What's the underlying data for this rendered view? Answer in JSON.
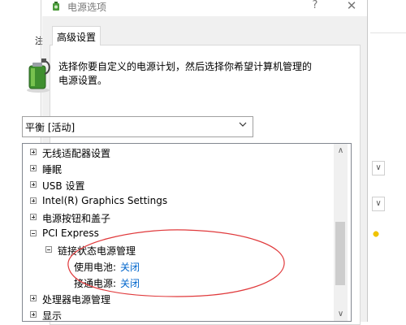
{
  "background": {
    "left_fragment": "注",
    "right_chevrons": [
      "∨",
      "∨"
    ]
  },
  "dialog": {
    "title": "电源选项",
    "help_label": "?",
    "close_label": "✕",
    "tab_label": "高级设置",
    "description": "选择你要自定义的电源计划，然后选择你希望计算机管理的电源设置。",
    "plan_select": {
      "value": "平衡 [活动]"
    },
    "tree": {
      "items": [
        {
          "label": "无线适配器设置",
          "state": "collapsed"
        },
        {
          "label": "睡眠",
          "state": "collapsed"
        },
        {
          "label": "USB 设置",
          "state": "collapsed"
        },
        {
          "label": "Intel(R) Graphics Settings",
          "state": "collapsed"
        },
        {
          "label": "电源按钮和盖子",
          "state": "collapsed"
        },
        {
          "label": "PCI Express",
          "state": "expanded"
        },
        {
          "label": "链接状态电源管理",
          "state": "expanded"
        },
        {
          "label": "使用电池:",
          "value": "关闭"
        },
        {
          "label": "接通电源:",
          "value": "关闭"
        },
        {
          "label": "处理器电源管理",
          "state": "collapsed"
        },
        {
          "label": "显示",
          "state": "collapsed"
        }
      ]
    },
    "scroll_up_label": "∧",
    "scroll_down_label": "∨",
    "annotation_color": "#e0393b"
  }
}
